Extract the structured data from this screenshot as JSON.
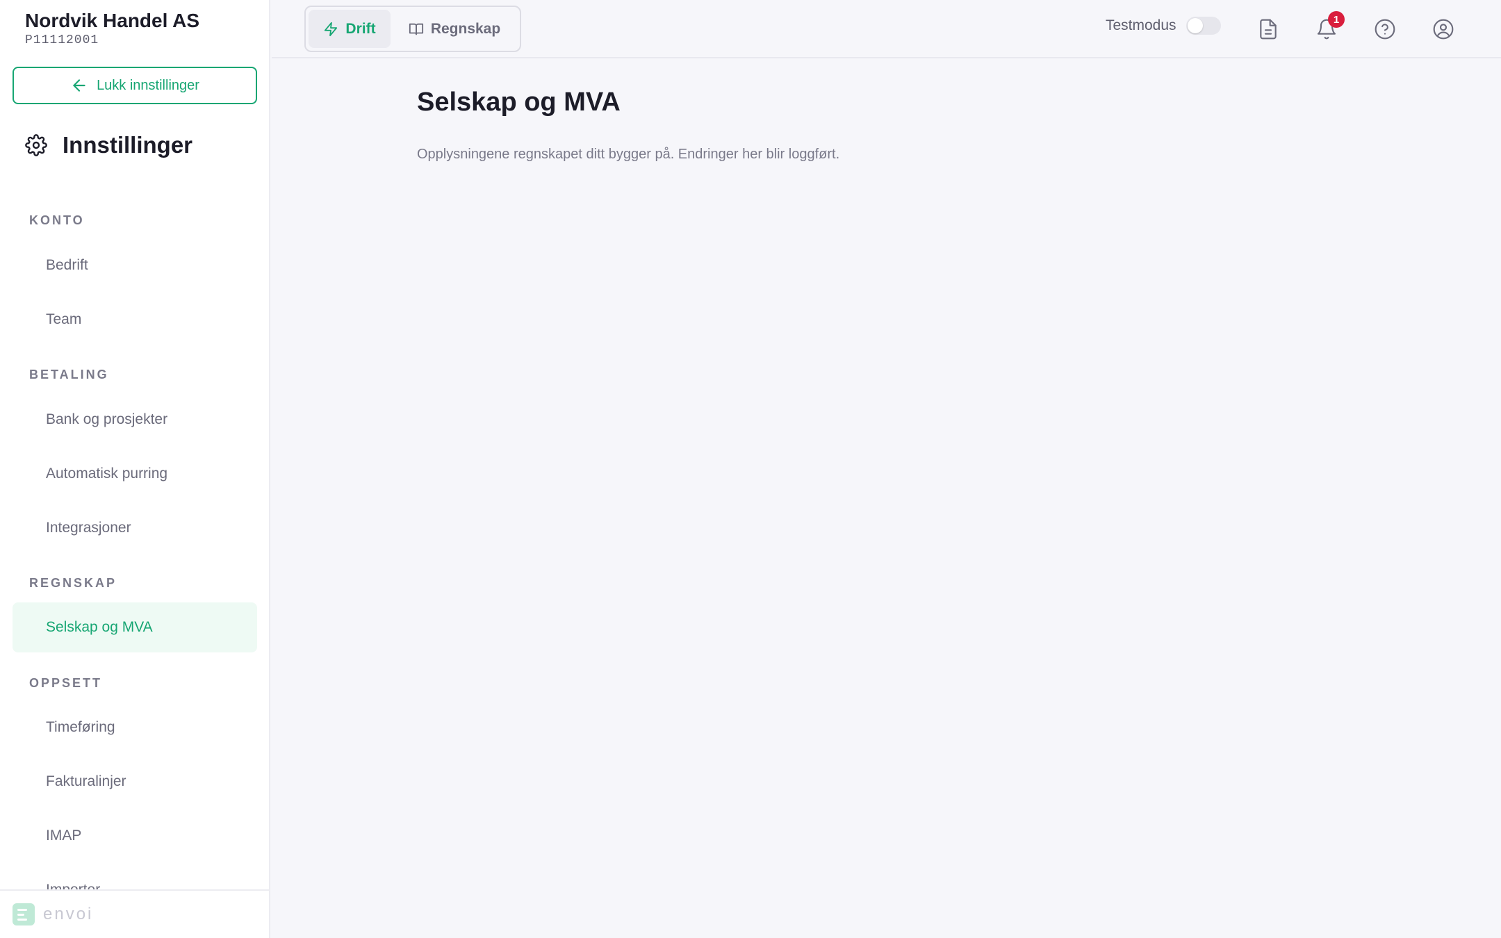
{
  "company": {
    "name": "Nordvik Handel AS",
    "id": "P11112001"
  },
  "sidebar": {
    "close_label": "Lukk innstillinger",
    "title": "Innstillinger",
    "sections": [
      {
        "label": "KONTO",
        "items": [
          "Bedrift",
          "Team"
        ]
      },
      {
        "label": "BETALING",
        "items": [
          "Bank og prosjekter",
          "Automatisk purring",
          "Integrasjoner"
        ]
      },
      {
        "label": "REGNSKAP",
        "items": [
          "Selskap og MVA"
        ]
      },
      {
        "label": "OPPSETT",
        "items": [
          "Timeføring",
          "Fakturalinjer",
          "IMAP",
          "Importer"
        ]
      }
    ],
    "active_item": "Selskap og MVA",
    "footer_logo": "envoi"
  },
  "topbar": {
    "tabs": [
      {
        "label": "Drift",
        "icon": "bolt-icon",
        "active": true
      },
      {
        "label": "Regnskap",
        "icon": "book-icon",
        "active": false
      }
    ],
    "testmodus_label": "Testmodus",
    "testmodus_on": false,
    "notification_count": "1",
    "icons": [
      "document-icon",
      "bell-icon",
      "help-icon",
      "user-icon"
    ]
  },
  "main": {
    "title": "Selskap og MVA",
    "subtitle": "Opplysningene regnskapet ditt bygger på. Endringer her blir loggført."
  },
  "colors": {
    "accent": "#17a673",
    "badge": "#d91e3d",
    "background": "#f6f6fa"
  }
}
